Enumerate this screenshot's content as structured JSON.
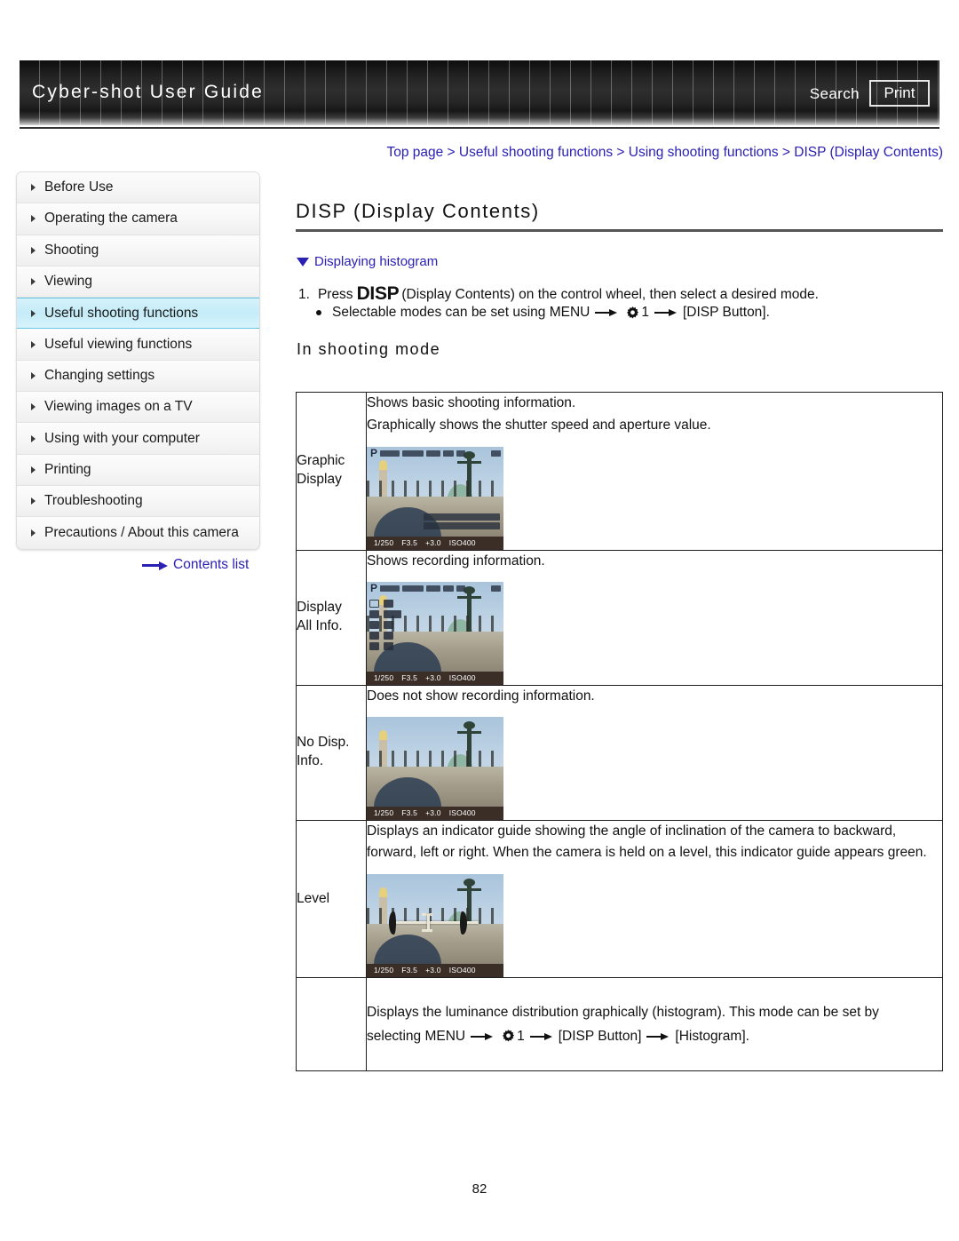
{
  "header": {
    "site_title": "Cyber-shot User Guide",
    "search_label": "Search",
    "print_label": "Print"
  },
  "breadcrumb": {
    "text": "Top page > Useful shooting functions > Using shooting functions > DISP (Display Contents)"
  },
  "sidebar": {
    "items": [
      {
        "label": "Before Use",
        "active": false
      },
      {
        "label": "Operating the camera",
        "active": false
      },
      {
        "label": "Shooting",
        "active": false
      },
      {
        "label": "Viewing",
        "active": false
      },
      {
        "label": "Useful shooting functions",
        "active": true
      },
      {
        "label": "Useful viewing functions",
        "active": false
      },
      {
        "label": "Changing settings",
        "active": false
      },
      {
        "label": "Viewing images on a TV",
        "active": false
      },
      {
        "label": "Using with your computer",
        "active": false
      },
      {
        "label": "Printing",
        "active": false
      },
      {
        "label": "Troubleshooting",
        "active": false
      },
      {
        "label": "Precautions / About this camera",
        "active": false
      }
    ],
    "contents_list_label": "Contents list"
  },
  "main": {
    "page_title": "DISP (Display Contents)",
    "histogram_link": "Displaying histogram",
    "step_number": "1.",
    "step_text_before": "Press",
    "step_disp": "DISP",
    "step_text_after": "(Display Contents) on the control wheel, then select a desired mode.",
    "bullet_before_arrow": "Selectable modes can be set using MENU",
    "bullet_gear_number": "1",
    "bullet_after_arrow": "[DISP Button].",
    "section_heading": "In shooting mode",
    "page_number": "82"
  },
  "table": {
    "rows": [
      {
        "mode": "Graphic Display",
        "mode_line1": "Graphic",
        "mode_line2": "Display",
        "desc_lines": [
          "Shows basic shooting information.",
          "Graphically shows the shutter speed and aperture value."
        ],
        "screen": {
          "variant": "graphic",
          "shutter": "1/250",
          "aperture": "F3.5",
          "exposure": "+3.0",
          "iso": "ISO400",
          "mode_mark": "P"
        }
      },
      {
        "mode": "Display All Info.",
        "mode_line1": "Display",
        "mode_line2": "All Info.",
        "desc_lines": [
          "Shows recording information."
        ],
        "screen": {
          "variant": "all-info",
          "shutter": "1/250",
          "aperture": "F3.5",
          "exposure": "+3.0",
          "iso": "ISO400",
          "mode_mark": "P"
        }
      },
      {
        "mode": "No Disp. Info.",
        "mode_line1": "No Disp.",
        "mode_line2": "Info.",
        "desc_lines": [
          "Does not show recording information."
        ],
        "screen": {
          "variant": "no-info",
          "shutter": "1/250",
          "aperture": "F3.5",
          "exposure": "+3.0",
          "iso": "ISO400",
          "mode_mark": ""
        }
      },
      {
        "mode": "Level",
        "mode_line1": "Level",
        "mode_line2": "",
        "desc_lines": [
          "Displays an indicator guide showing the angle of inclination of the camera to backward, forward, left or right. When the camera is held on a level, this indicator guide appears green."
        ],
        "screen": {
          "variant": "level",
          "shutter": "1/250",
          "aperture": "F3.5",
          "exposure": "+3.0",
          "iso": "ISO400",
          "mode_mark": ""
        }
      },
      {
        "mode": "Histogram",
        "mode_line1": "",
        "mode_line2": "",
        "desc_lines": [
          "Displays the luminance distribution graphically (histogram). This mode can be set by",
          "selecting MENU"
        ],
        "desc_tail_1": "1",
        "desc_tail_2": "[DISP Button]",
        "desc_tail_3": "[Histogram].",
        "screen": null
      }
    ]
  },
  "colors": {
    "link": "#2a20b4",
    "active_nav": "#c4ecf8",
    "active_nav_border": "#63c3e0",
    "header_dark": "#242424",
    "table_border": "#1e1e1e"
  }
}
